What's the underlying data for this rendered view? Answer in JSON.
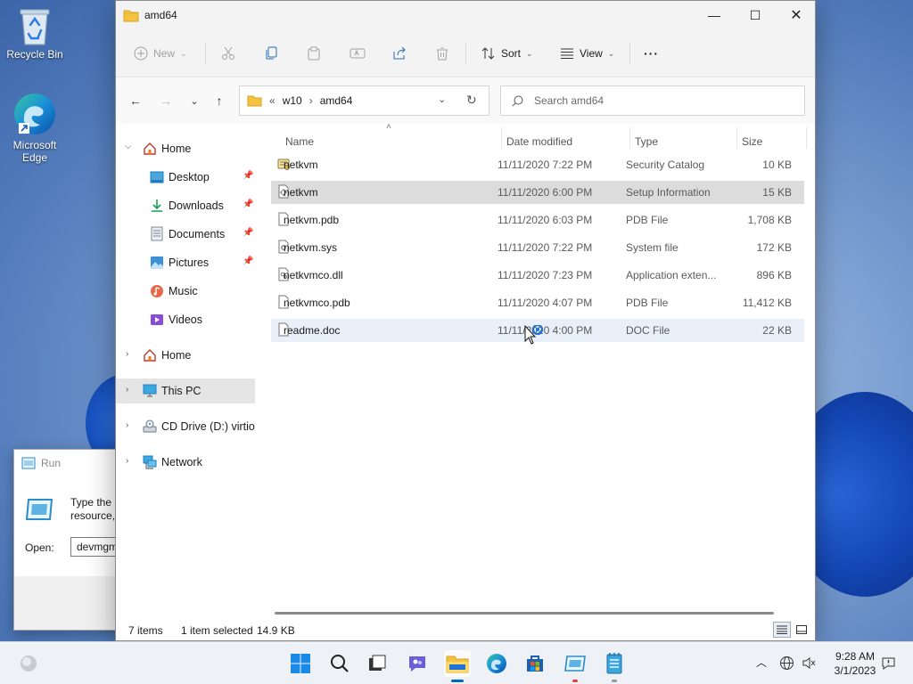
{
  "desktop": {
    "icons": [
      {
        "label": "Recycle Bin"
      },
      {
        "label": "Microsoft Edge"
      }
    ]
  },
  "run_dialog": {
    "title": "Run",
    "desc_line1": "Type the n",
    "desc_line2": "resource,",
    "open_label": "Open:",
    "open_value": "devmgm"
  },
  "window": {
    "title": "amd64",
    "controls": {
      "minimize": "—",
      "maximize": "☐",
      "close": "✕"
    }
  },
  "toolbar": {
    "new_label": "New",
    "sort_label": "Sort",
    "view_label": "View",
    "more_label": "···"
  },
  "address": {
    "overflow": "«",
    "crumbs": [
      "w10",
      "amd64"
    ],
    "separator": "›"
  },
  "search": {
    "placeholder": "Search amd64"
  },
  "nav": {
    "items": [
      {
        "label": "Home"
      },
      {
        "label": "Desktop"
      },
      {
        "label": "Downloads"
      },
      {
        "label": "Documents"
      },
      {
        "label": "Pictures"
      },
      {
        "label": "Music"
      },
      {
        "label": "Videos"
      },
      {
        "label": "Home"
      },
      {
        "label": "This PC"
      },
      {
        "label": "CD Drive (D:) virtio-w"
      },
      {
        "label": "Network"
      }
    ]
  },
  "columns": {
    "name": "Name",
    "date": "Date modified",
    "type": "Type",
    "size": "Size"
  },
  "files": [
    {
      "name": "netkvm",
      "date": "11/11/2020 7:22 PM",
      "type": "Security Catalog",
      "size": "10 KB"
    },
    {
      "name": "netkvm",
      "date": "11/11/2020 6:00 PM",
      "type": "Setup Information",
      "size": "15 KB"
    },
    {
      "name": "netkvm.pdb",
      "date": "11/11/2020 6:03 PM",
      "type": "PDB File",
      "size": "1,708 KB"
    },
    {
      "name": "netkvm.sys",
      "date": "11/11/2020 7:22 PM",
      "type": "System file",
      "size": "172 KB"
    },
    {
      "name": "netkvmco.dll",
      "date": "11/11/2020 7:23 PM",
      "type": "Application exten...",
      "size": "896 KB"
    },
    {
      "name": "netkvmco.pdb",
      "date": "11/11/2020 4:07 PM",
      "type": "PDB File",
      "size": "11,412 KB"
    },
    {
      "name": "readme.doc",
      "date": "11/11/2020 4:00 PM",
      "type": "DOC File",
      "size": "22 KB"
    }
  ],
  "status": {
    "items": "7 items",
    "selected": "1 item selected",
    "size": "14.9 KB"
  },
  "taskbar": {
    "time": "9:28 AM",
    "date": "3/1/2023"
  },
  "colors": {
    "accent": "#0067c0",
    "folder": "#f4c242",
    "selection": "#dcdcdc"
  }
}
